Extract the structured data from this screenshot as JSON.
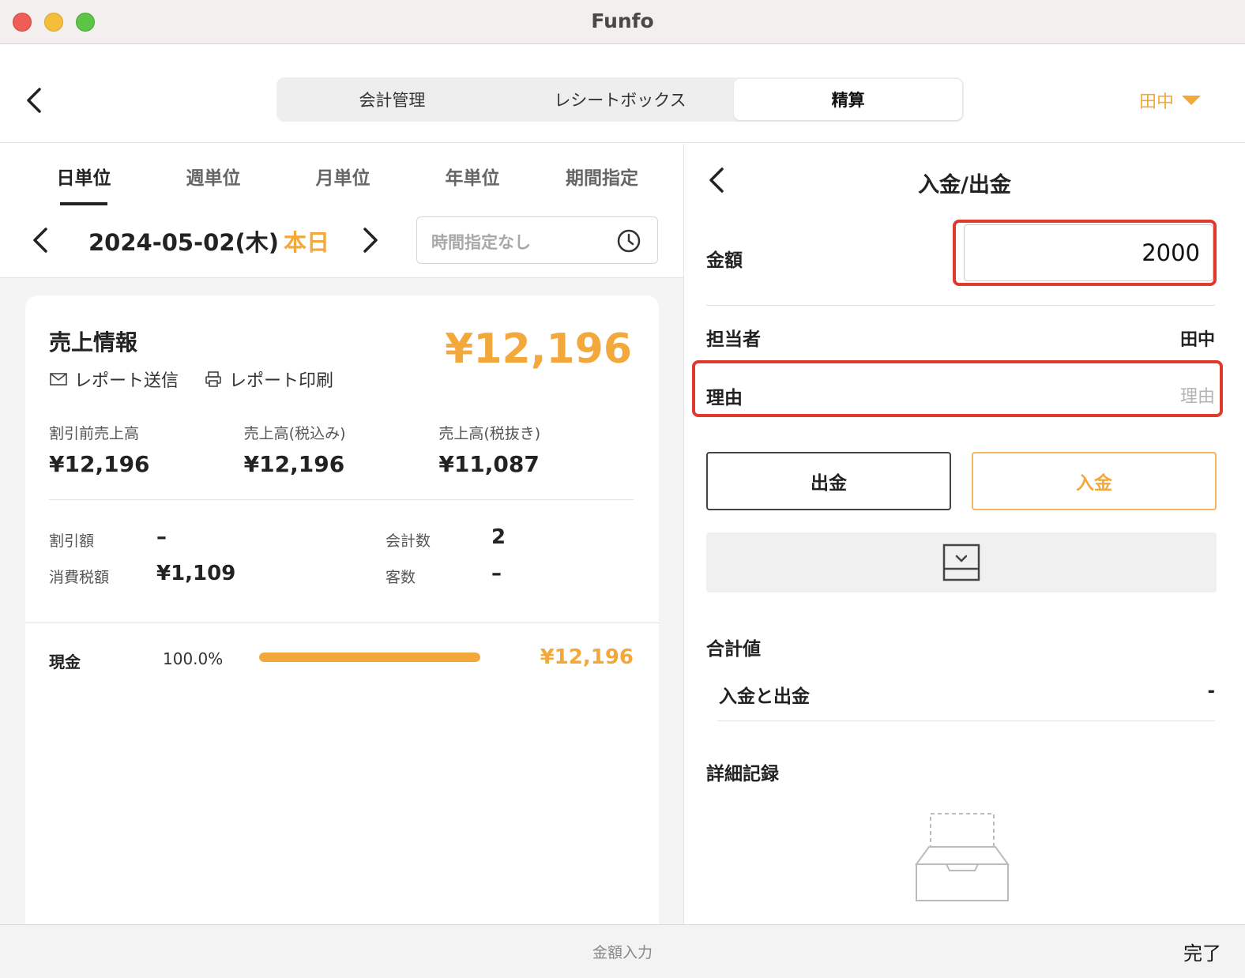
{
  "window": {
    "title": "Funfo"
  },
  "nav": {
    "tabs": [
      {
        "label": "会計管理"
      },
      {
        "label": "レシートボックス"
      },
      {
        "label": "精算"
      }
    ],
    "user": "田中"
  },
  "period_tabs": [
    "日単位",
    "週単位",
    "月単位",
    "年単位",
    "期間指定"
  ],
  "date": {
    "text": "2024-05-02(木)",
    "today": "本日",
    "time_placeholder": "時間指定なし"
  },
  "sales": {
    "title": "売上情報",
    "total": "¥12,196",
    "actions": {
      "send": "レポート送信",
      "print": "レポート印刷"
    },
    "metrics": [
      {
        "label": "割引前売上高",
        "value": "¥12,196"
      },
      {
        "label": "売上高(税込み)",
        "value": "¥12,196"
      },
      {
        "label": "売上高(税抜き)",
        "value": "¥11,087"
      }
    ],
    "discount_label": "割引額",
    "discount_value": "–",
    "tax_label": "消費税額",
    "tax_value": "¥1,109",
    "count_label": "会計数",
    "count_value": "2",
    "guests_label": "客数",
    "guests_value": "–",
    "cash": {
      "label": "現金",
      "percent": "100.0%",
      "fill": 1.0,
      "amount": "¥12,196"
    }
  },
  "cashio": {
    "title": "入金/出金",
    "amount_label": "金額",
    "amount_value": "2000",
    "staff_label": "担当者",
    "staff_value": "田中",
    "reason_label": "理由",
    "reason_placeholder": "理由",
    "out_button": "出金",
    "in_button": "入金",
    "summary_title": "合計値",
    "summary_row_label": "入金と出金",
    "summary_row_value": "-",
    "detail_title": "詳細記録"
  },
  "bottom": {
    "center": "金額入力",
    "done": "完了"
  },
  "colors": {
    "accent": "#f2a83b",
    "highlight": "#e03a2f"
  }
}
